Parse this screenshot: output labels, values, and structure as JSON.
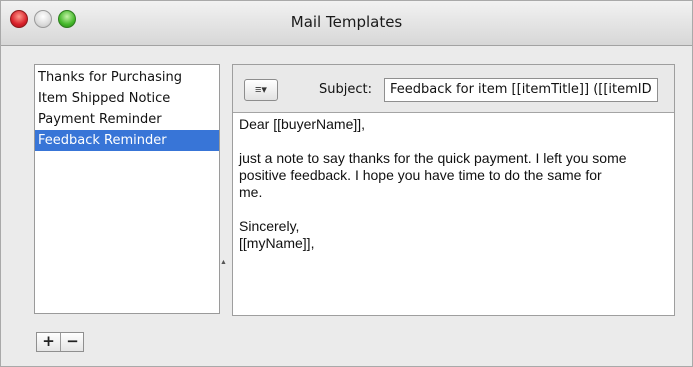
{
  "window": {
    "title": "Mail Templates"
  },
  "templates": [
    {
      "label": "Thanks for Purchasing",
      "selected": false
    },
    {
      "label": "Item Shipped Notice",
      "selected": false
    },
    {
      "label": "Payment Reminder",
      "selected": false
    },
    {
      "label": "Feedback Reminder",
      "selected": true
    }
  ],
  "editor": {
    "format_button_label": "≡▾",
    "subject_label": "Subject:",
    "subject_value": "Feedback for item [[itemTitle]] ([[itemID",
    "body": {
      "greeting": "Dear [[buyerName]],",
      "line1": "just a note to say thanks for the quick payment. I left you some",
      "line2": "positive feedback. I hope you have time to do the same for",
      "line3": "me.",
      "closing": "Sincerely,",
      "signature": "[[myName]],"
    }
  },
  "controls": {
    "add_label": "+",
    "remove_label": "−"
  },
  "colors": {
    "selection": "#3875d7"
  }
}
